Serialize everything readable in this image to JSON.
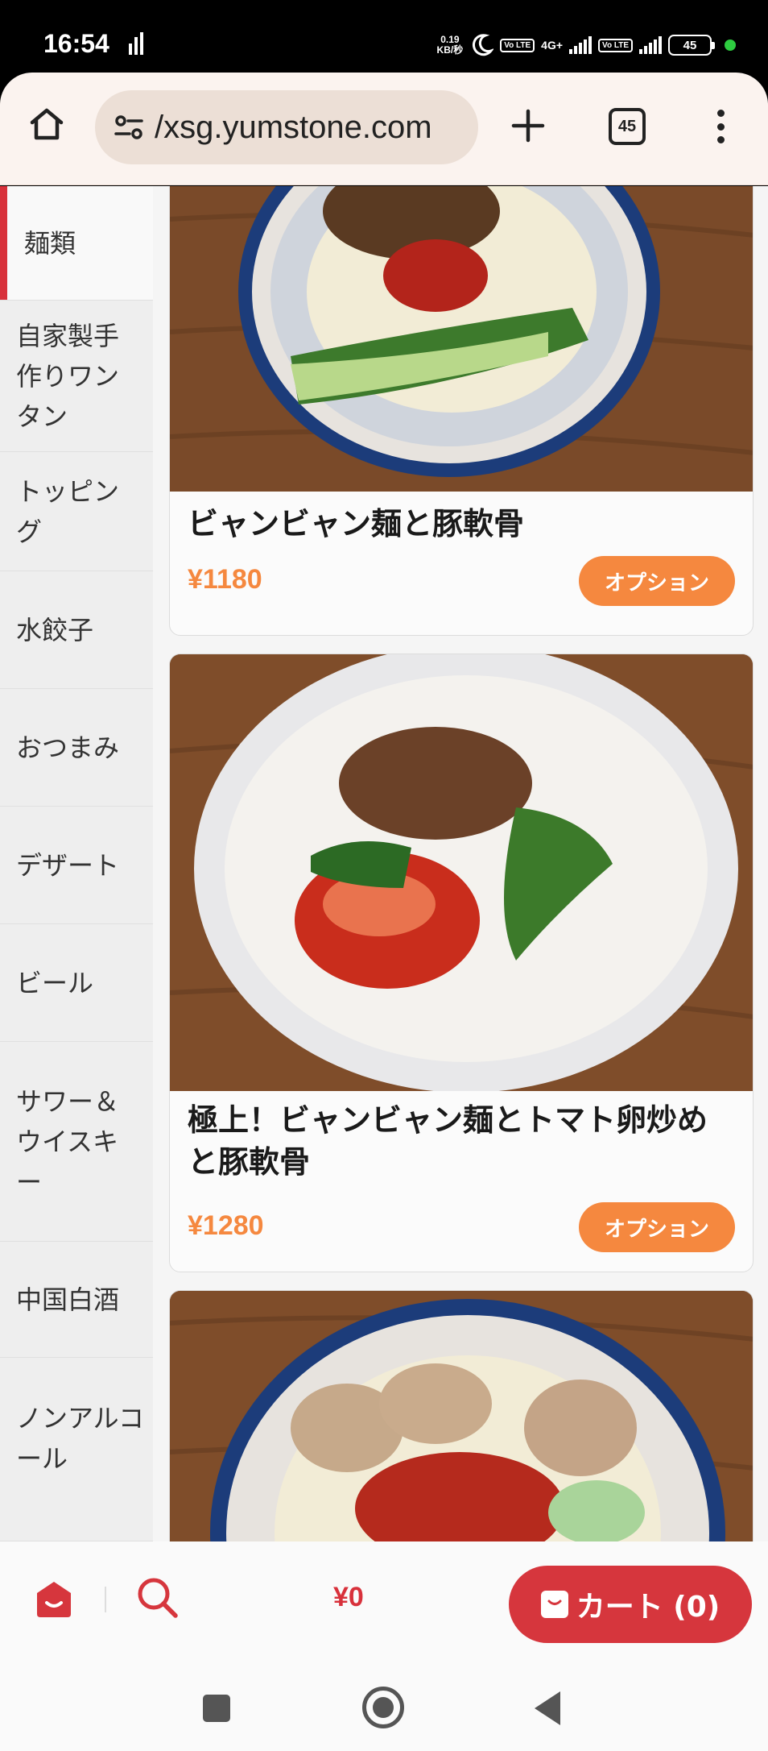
{
  "status_bar": {
    "time": "16:54",
    "net_speed_value": "0.19",
    "net_speed_unit": "KB/秒",
    "volte1": "Vo LTE",
    "network": "4G+",
    "volte2": "Vo LTE",
    "battery": "45",
    "icons": [
      "signal-bars-icon",
      "moon-icon",
      "battery-icon",
      "active-dot-icon"
    ]
  },
  "browser": {
    "url": "/xsg.yumstone.com",
    "tab_count": "45",
    "icons": [
      "home-icon",
      "site-settings-icon",
      "plus-icon",
      "tabs-icon",
      "more-vert-icon"
    ]
  },
  "sidebar": {
    "categories": [
      {
        "label": "麺類",
        "active": true
      },
      {
        "label": "自家製手作りワンタン",
        "active": false
      },
      {
        "label": "トッピング",
        "active": false
      },
      {
        "label": "水餃子",
        "active": false
      },
      {
        "label": "おつまみ",
        "active": false
      },
      {
        "label": "デザート",
        "active": false
      },
      {
        "label": "ビール",
        "active": false
      },
      {
        "label": "サワー＆ウイスキー",
        "active": false
      },
      {
        "label": "中国白酒",
        "active": false
      },
      {
        "label": "ノンアルコール",
        "active": false
      }
    ]
  },
  "menu_items": [
    {
      "name": "ビャンビャン麺と豚軟骨",
      "price": "¥1180",
      "option_label": "オプション"
    },
    {
      "name": "極上！ビャンビャン麺とトマト卵炒めと豚軟骨",
      "price": "¥1280",
      "option_label": "オプション"
    },
    {
      "name": "",
      "price": "",
      "option_label": ""
    }
  ],
  "bottom_bar": {
    "total": "¥0",
    "cart_label": "カート (0)",
    "icons": [
      "store-home-icon",
      "search-icon",
      "cart-icon"
    ]
  },
  "colors": {
    "accent_red": "#d6363d",
    "accent_orange": "#f5883f"
  }
}
